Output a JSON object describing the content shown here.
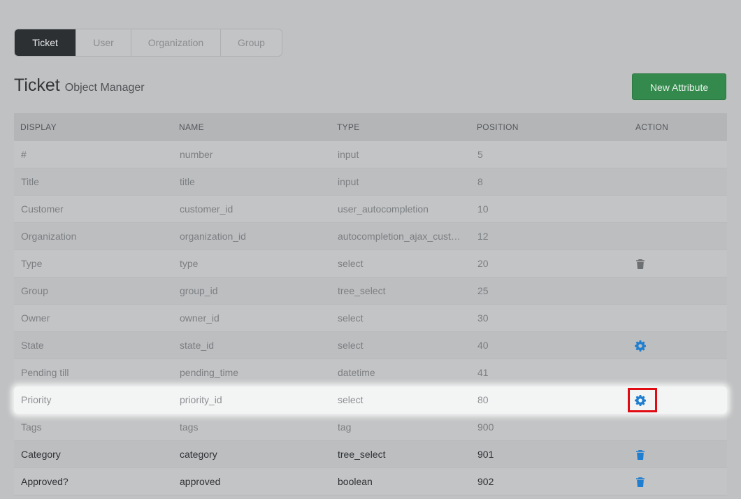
{
  "tabs": [
    {
      "label": "Ticket",
      "active": true
    },
    {
      "label": "User",
      "active": false
    },
    {
      "label": "Organization",
      "active": false
    },
    {
      "label": "Group",
      "active": false
    }
  ],
  "header": {
    "title": "Ticket",
    "subtitle": "Object Manager",
    "new_attribute_label": "New Attribute"
  },
  "table": {
    "columns": [
      "DISPLAY",
      "NAME",
      "TYPE",
      "POSITION",
      "ACTION"
    ],
    "rows": [
      {
        "display": "#",
        "name": "number",
        "type": "input",
        "position": "5",
        "action": "none"
      },
      {
        "display": "Title",
        "name": "title",
        "type": "input",
        "position": "8",
        "action": "none"
      },
      {
        "display": "Customer",
        "name": "customer_id",
        "type": "user_autocompletion",
        "position": "10",
        "action": "none"
      },
      {
        "display": "Organization",
        "name": "organization_id",
        "type": "autocompletion_ajax_customer_organization",
        "position": "12",
        "action": "none"
      },
      {
        "display": "Type",
        "name": "type",
        "type": "select",
        "position": "20",
        "action": "trash-gray"
      },
      {
        "display": "Group",
        "name": "group_id",
        "type": "tree_select",
        "position": "25",
        "action": "none"
      },
      {
        "display": "Owner",
        "name": "owner_id",
        "type": "select",
        "position": "30",
        "action": "none"
      },
      {
        "display": "State",
        "name": "state_id",
        "type": "select",
        "position": "40",
        "action": "gear"
      },
      {
        "display": "Pending till",
        "name": "pending_time",
        "type": "datetime",
        "position": "41",
        "action": "none"
      },
      {
        "display": "Priority",
        "name": "priority_id",
        "type": "select",
        "position": "80",
        "action": "gear-highlighted"
      },
      {
        "display": "Tags",
        "name": "tags",
        "type": "tag",
        "position": "900",
        "action": "none"
      },
      {
        "display": "Category",
        "name": "category",
        "type": "tree_select",
        "position": "901",
        "action": "trash-blue"
      },
      {
        "display": "Approved?",
        "name": "approved",
        "type": "boolean",
        "position": "902",
        "action": "trash-blue"
      }
    ]
  },
  "colors": {
    "accent_green": "#338a4c",
    "icon_blue": "#1f7ed0",
    "highlight_red": "#e10b13"
  },
  "icons": {
    "gear": "gear-icon",
    "trash": "trash-icon"
  }
}
